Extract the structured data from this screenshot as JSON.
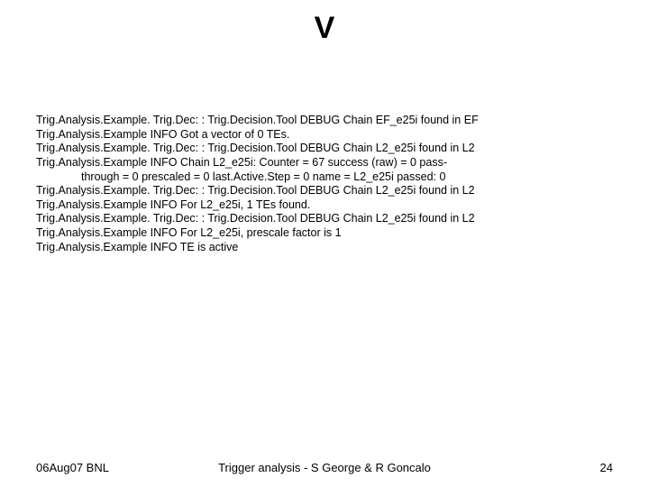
{
  "title": "V",
  "log": {
    "lines": [
      "Trig.Analysis.Example. Trig.Dec: : Trig.Decision.Tool      DEBUG Chain EF_e25i found in EF",
      "Trig.Analysis.Example                                         INFO Got a vector of 0 TEs.",
      "Trig.Analysis.Example. Trig.Dec: : Trig.Decision.Tool      DEBUG Chain L2_e25i found in L2",
      "Trig.Analysis.Example                                         INFO Chain L2_e25i: Counter = 67 success (raw) = 0 pass-",
      "through = 0 prescaled = 0 last.Active.Step = 0               name = L2_e25i passed: 0",
      "Trig.Analysis.Example. Trig.Dec: : Trig.Decision.Tool      DEBUG Chain L2_e25i found in L2",
      "Trig.Analysis.Example                                         INFO For L2_e25i, 1 TEs found.",
      "Trig.Analysis.Example. Trig.Dec: : Trig.Decision.Tool      DEBUG Chain L2_e25i found in L2",
      "Trig.Analysis.Example                                         INFO For L2_e25i, prescale factor is 1",
      "Trig.Analysis.Example                                         INFO TE is active"
    ],
    "indent_flags": [
      false,
      false,
      false,
      false,
      true,
      false,
      false,
      false,
      false,
      false
    ]
  },
  "footer": {
    "left": "06Aug07 BNL",
    "center": "Trigger analysis - S George & R Goncalo",
    "right": "24"
  }
}
